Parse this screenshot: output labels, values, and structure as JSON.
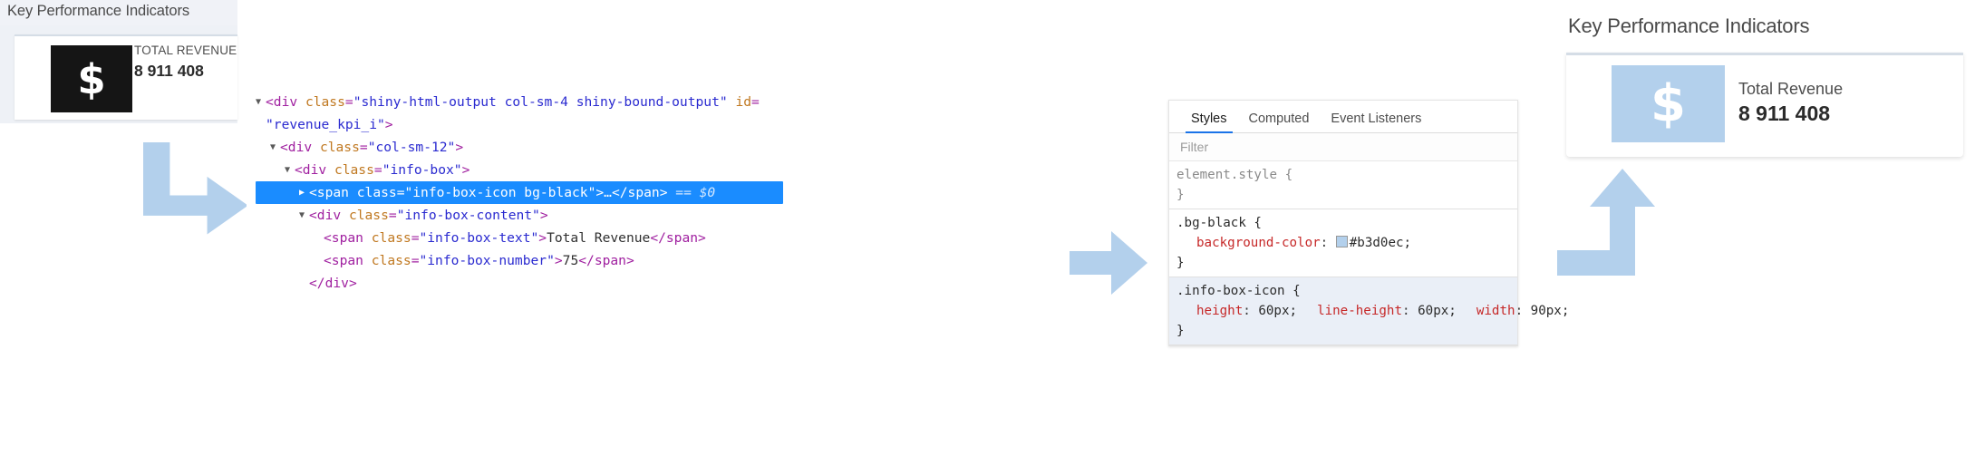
{
  "kpi_before": {
    "title": "Key Performance Indicators",
    "icon": "dollar-sign-icon",
    "icon_glyph": "$",
    "label": "TOTAL REVENUE",
    "value": "8 911 408",
    "icon_bg": "#151515"
  },
  "kpi_after": {
    "title": "Key Performance Indicators",
    "icon": "dollar-sign-icon",
    "icon_glyph": "$",
    "label": "Total Revenue",
    "value": "8 911 408",
    "icon_bg": "#b3d0ec"
  },
  "arrows": {
    "color": "#b3d0ec",
    "left": "elbow-arrow-down-right",
    "middle": "arrow-right",
    "right": "elbow-arrow-right-up"
  },
  "dom_tree": {
    "lines": [
      {
        "indent": 0,
        "marker": "open",
        "parts": [
          {
            "t": "punct",
            "s": "<"
          },
          {
            "t": "tag",
            "s": "div"
          },
          {
            "t": "space",
            "s": " "
          },
          {
            "t": "attr",
            "s": "class"
          },
          {
            "t": "punct",
            "s": "="
          },
          {
            "t": "val",
            "s": "\"shiny-html-output col-sm-4 shiny-bound-output\""
          },
          {
            "t": "space",
            "s": " "
          },
          {
            "t": "attr",
            "s": "id"
          },
          {
            "t": "punct",
            "s": "="
          }
        ]
      },
      {
        "indent": 0,
        "marker": "blank",
        "parts": [
          {
            "t": "val",
            "s": "\"revenue_kpi_i\""
          },
          {
            "t": "punct",
            "s": ">"
          }
        ]
      },
      {
        "indent": 1,
        "marker": "open",
        "parts": [
          {
            "t": "punct",
            "s": "<"
          },
          {
            "t": "tag",
            "s": "div"
          },
          {
            "t": "space",
            "s": " "
          },
          {
            "t": "attr",
            "s": "class"
          },
          {
            "t": "punct",
            "s": "="
          },
          {
            "t": "val",
            "s": "\"col-sm-12\""
          },
          {
            "t": "punct",
            "s": ">"
          }
        ]
      },
      {
        "indent": 2,
        "marker": "open",
        "parts": [
          {
            "t": "punct",
            "s": "<"
          },
          {
            "t": "tag",
            "s": "div"
          },
          {
            "t": "space",
            "s": " "
          },
          {
            "t": "attr",
            "s": "class"
          },
          {
            "t": "punct",
            "s": "="
          },
          {
            "t": "val",
            "s": "\"info-box\""
          },
          {
            "t": "punct",
            "s": ">"
          }
        ]
      },
      {
        "indent": 3,
        "marker": "closed",
        "selected": true,
        "parts": [
          {
            "t": "punct",
            "s": "<"
          },
          {
            "t": "tag",
            "s": "span"
          },
          {
            "t": "space",
            "s": " "
          },
          {
            "t": "attr",
            "s": "class"
          },
          {
            "t": "punct",
            "s": "="
          },
          {
            "t": "val",
            "s": "\"info-box-icon bg-black\""
          },
          {
            "t": "punct",
            "s": ">"
          },
          {
            "t": "txt",
            "s": "…"
          },
          {
            "t": "punct",
            "s": "</"
          },
          {
            "t": "tag",
            "s": "span"
          },
          {
            "t": "punct",
            "s": ">"
          },
          {
            "t": "space",
            "s": " "
          },
          {
            "t": "dollar0",
            "s": "== $0"
          }
        ]
      },
      {
        "indent": 3,
        "marker": "open",
        "parts": [
          {
            "t": "punct",
            "s": "<"
          },
          {
            "t": "tag",
            "s": "div"
          },
          {
            "t": "space",
            "s": " "
          },
          {
            "t": "attr",
            "s": "class"
          },
          {
            "t": "punct",
            "s": "="
          },
          {
            "t": "val",
            "s": "\"info-box-content\""
          },
          {
            "t": "punct",
            "s": ">"
          }
        ]
      },
      {
        "indent": 4,
        "marker": "blank",
        "parts": [
          {
            "t": "punct",
            "s": "<"
          },
          {
            "t": "tag",
            "s": "span"
          },
          {
            "t": "space",
            "s": " "
          },
          {
            "t": "attr",
            "s": "class"
          },
          {
            "t": "punct",
            "s": "="
          },
          {
            "t": "val",
            "s": "\"info-box-text\""
          },
          {
            "t": "punct",
            "s": ">"
          },
          {
            "t": "txt",
            "s": "Total Revenue"
          },
          {
            "t": "punct",
            "s": "</"
          },
          {
            "t": "tag",
            "s": "span"
          },
          {
            "t": "punct",
            "s": ">"
          }
        ]
      },
      {
        "indent": 4,
        "marker": "blank",
        "parts": [
          {
            "t": "punct",
            "s": "<"
          },
          {
            "t": "tag",
            "s": "span"
          },
          {
            "t": "space",
            "s": " "
          },
          {
            "t": "attr",
            "s": "class"
          },
          {
            "t": "punct",
            "s": "="
          },
          {
            "t": "val",
            "s": "\"info-box-number\""
          },
          {
            "t": "punct",
            "s": ">"
          },
          {
            "t": "txt",
            "s": "75"
          },
          {
            "t": "punct",
            "s": "</"
          },
          {
            "t": "tag",
            "s": "span"
          },
          {
            "t": "punct",
            "s": ">"
          }
        ]
      },
      {
        "indent": 3,
        "marker": "blank",
        "parts": [
          {
            "t": "punct",
            "s": "</"
          },
          {
            "t": "tag",
            "s": "div"
          },
          {
            "t": "punct",
            "s": ">"
          }
        ]
      }
    ]
  },
  "styles_panel": {
    "tabs": [
      {
        "label": "Styles",
        "active": true
      },
      {
        "label": "Computed",
        "active": false
      },
      {
        "label": "Event Listeners",
        "active": false
      }
    ],
    "filter_placeholder": "Filter",
    "rules": [
      {
        "selector": "element.style",
        "gray": true,
        "shaded": false,
        "declarations": []
      },
      {
        "selector": ".bg-black",
        "gray": false,
        "shaded": false,
        "declarations": [
          {
            "property": "background-color",
            "value": "#b3d0ec",
            "swatch": "#b3d0ec"
          }
        ]
      },
      {
        "selector": ".info-box-icon",
        "gray": false,
        "shaded": true,
        "declarations": [
          {
            "property": "height",
            "value": "60px"
          },
          {
            "property": "line-height",
            "value": "60px"
          },
          {
            "property": "width",
            "value": "90px"
          }
        ]
      }
    ]
  }
}
